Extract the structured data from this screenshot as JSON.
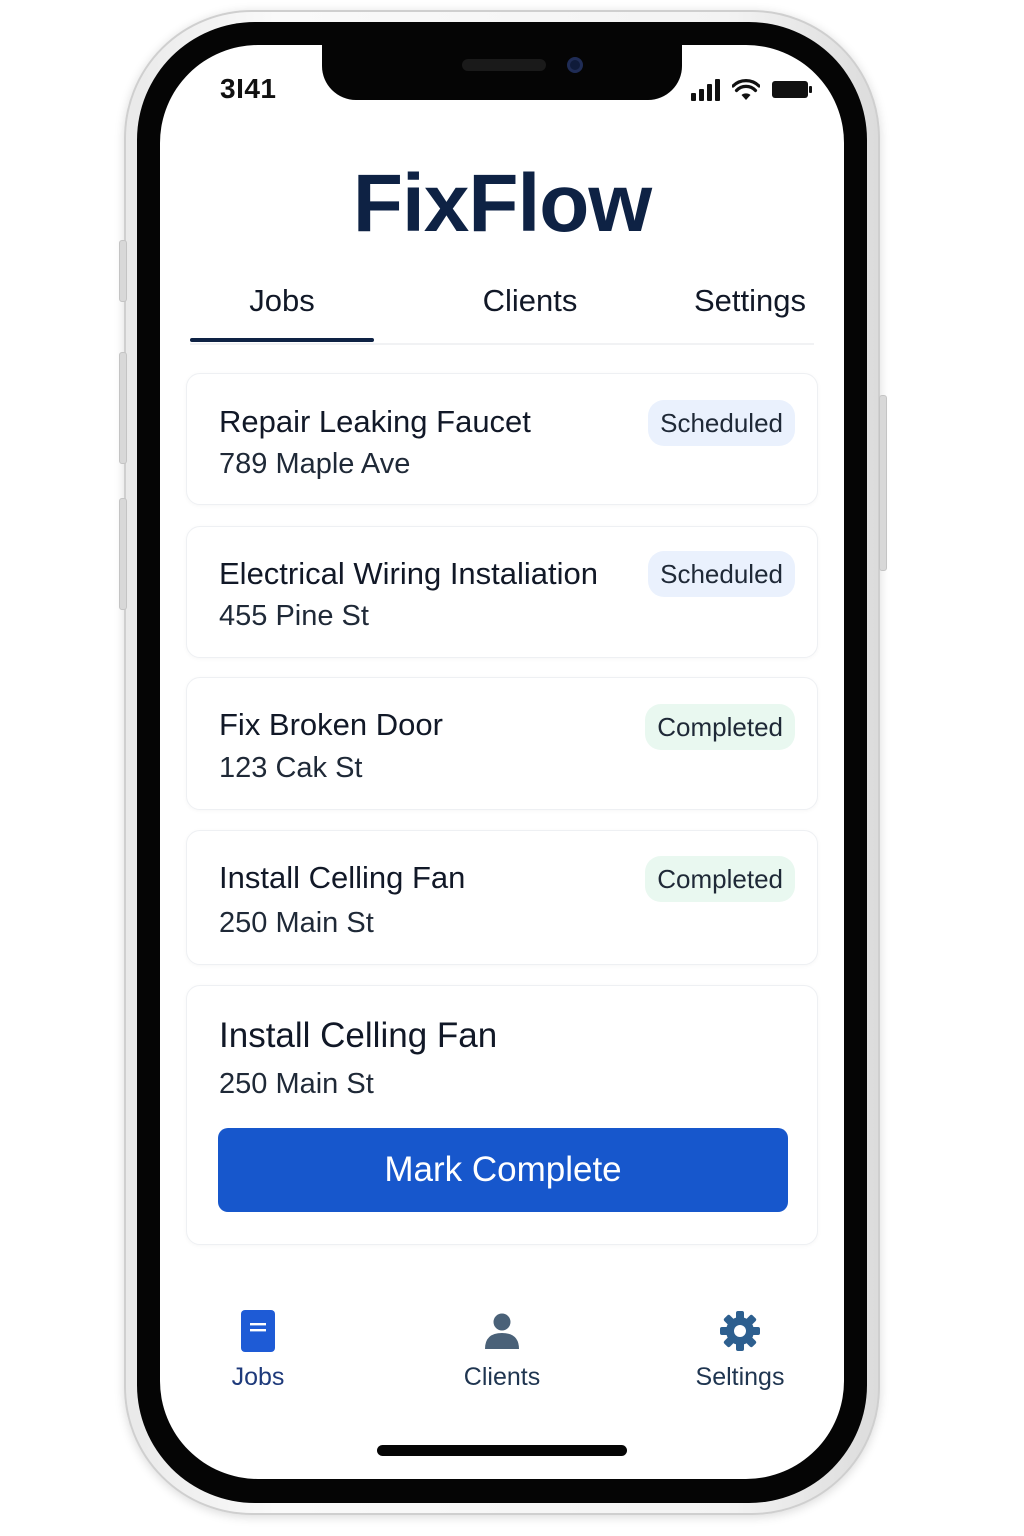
{
  "status_bar": {
    "time": "3I41"
  },
  "app": {
    "title": "FixFlow"
  },
  "tabs": [
    {
      "label": "Jobs",
      "active": true
    },
    {
      "label": "Clients",
      "active": false
    },
    {
      "label": "Settings",
      "active": false
    }
  ],
  "jobs": [
    {
      "title": "Repair Leaking Faucet",
      "address": "789 Maple Ave",
      "status": "Scheduled"
    },
    {
      "title": "Electrical Wiring Instaliation",
      "address": "455 Pine St",
      "status": "Scheduled"
    },
    {
      "title": "Fix Broken Door",
      "address": "123 Cak St",
      "status": "Completed"
    },
    {
      "title": "Install Celling Fan",
      "address": "250 Main St",
      "status": "Completed"
    }
  ],
  "selected_job": {
    "title": "Install Celling Fan",
    "address": "250 Main St",
    "action_label": "Mark Complete"
  },
  "bottom_nav": [
    {
      "label": "Jobs",
      "icon": "document-icon",
      "active": true
    },
    {
      "label": "Clients",
      "icon": "person-icon",
      "active": false
    },
    {
      "label": "Seltings",
      "icon": "gear-icon",
      "active": false
    }
  ],
  "colors": {
    "brand": "#0e2244",
    "primary_button": "#1757cc",
    "scheduled_badge": "#eaf1fd",
    "completed_badge": "#e9f8f0"
  }
}
